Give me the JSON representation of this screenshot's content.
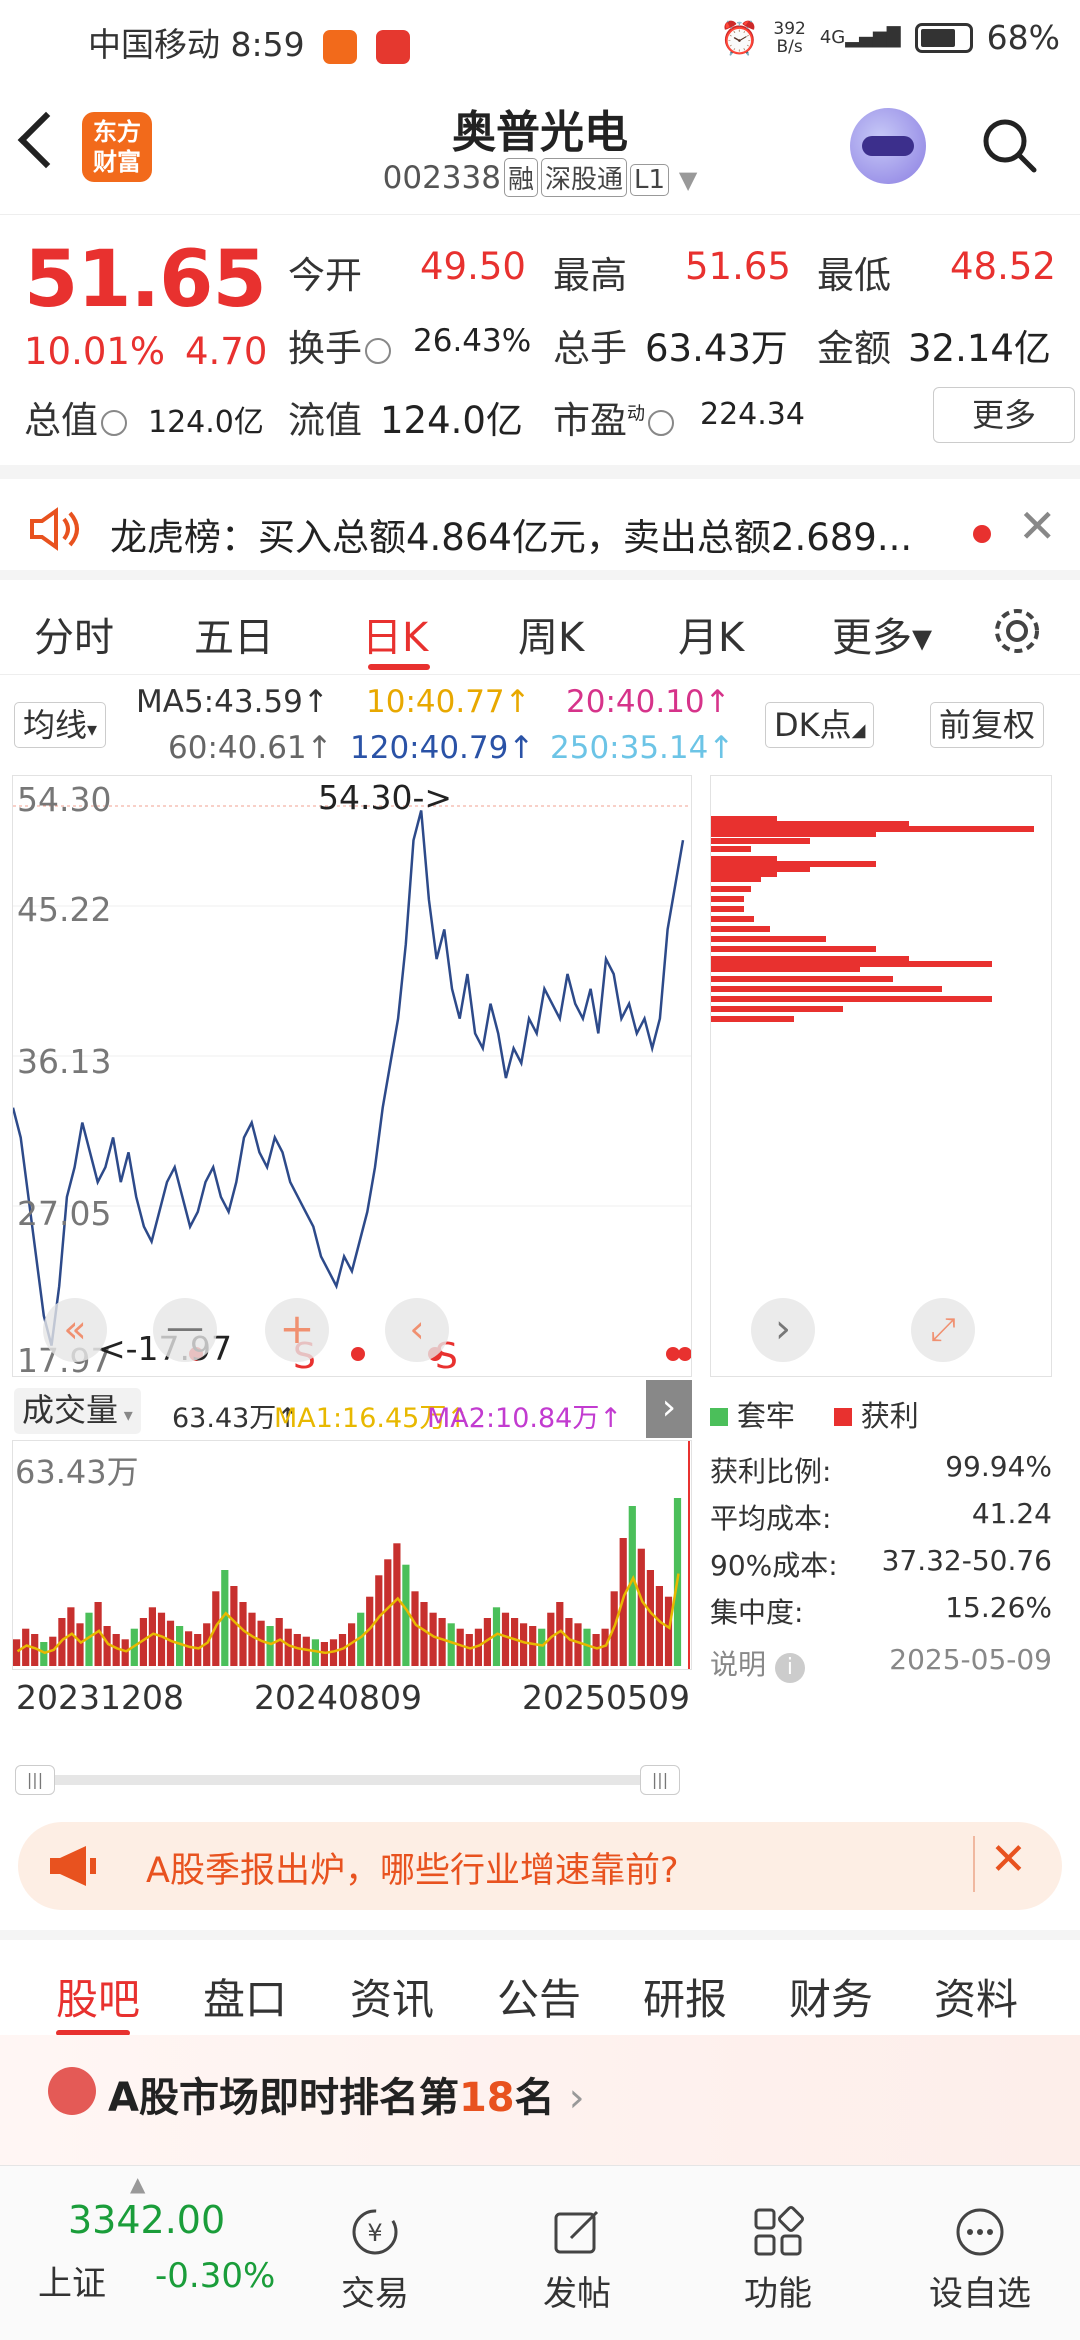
{
  "status": {
    "carrier": "中国移动",
    "time": "8:59",
    "net_speed_value": "392",
    "net_speed_unit": "B/s",
    "signal": "4G",
    "battery": "68%"
  },
  "header": {
    "logo_line1": "东方",
    "logo_line2": "财富",
    "title": "奥普光电",
    "code": "002338",
    "tags": [
      "融",
      "深股通",
      "L1"
    ]
  },
  "quote": {
    "price": "51.65",
    "change_pct": "10.01%",
    "change_amt": "4.70",
    "open_label": "今开",
    "open": "49.50",
    "high_label": "最高",
    "high": "51.65",
    "low_label": "最低",
    "low": "48.52",
    "turnover_label": "换手",
    "turnover": "26.43%",
    "volume_label": "总手",
    "volume": "63.43万",
    "amount_label": "金额",
    "amount": "32.14亿",
    "mktcap_label": "总值",
    "mktcap": "124.0亿",
    "float_label": "流值",
    "float": "124.0亿",
    "pe_label": "市盈",
    "pe_sup": "动",
    "pe": "224.34",
    "more_label": "更多"
  },
  "announce": {
    "text": "龙虎榜：买入总额4.864亿元，卖出总额2.689..."
  },
  "tabs": [
    {
      "label": "分时"
    },
    {
      "label": "五日"
    },
    {
      "label": "日K"
    },
    {
      "label": "周K"
    },
    {
      "label": "月K"
    },
    {
      "label": "更多▾"
    }
  ],
  "ma": {
    "select": "均线",
    "ma5": "MA5:43.59↑",
    "ma10": "10:40.77↑",
    "ma20": "20:40.10↑",
    "ma60": "60:40.61↑",
    "ma120": "120:40.79↑",
    "ma250": "250:35.14↑",
    "dk": "DK点",
    "fq": "前复权"
  },
  "chart_data": {
    "type": "line",
    "title": "",
    "y_ticks": [
      "54.30",
      "45.22",
      "36.13",
      "27.05",
      "17.97"
    ],
    "ylim": [
      17.97,
      54.3
    ],
    "max_label": "54.30->",
    "min_label": "<-17.97",
    "x_ticks": [
      "20231208",
      "20240809",
      "20250509"
    ],
    "close": [
      34,
      32,
      28,
      24,
      20,
      18,
      22,
      28,
      30,
      33,
      31,
      29,
      30,
      32,
      29,
      31,
      28,
      26,
      25,
      27,
      29,
      30,
      28,
      26,
      27,
      29,
      30,
      28,
      27,
      29,
      32,
      33,
      31,
      30,
      32,
      31,
      29,
      28,
      27,
      26,
      24,
      23,
      22,
      24,
      23,
      25,
      27,
      30,
      34,
      37,
      40,
      45,
      52,
      54,
      48,
      44,
      46,
      42,
      40,
      43,
      39,
      38,
      41,
      39,
      36,
      38,
      37,
      40,
      39,
      42,
      41,
      40,
      43,
      41,
      40,
      42,
      39,
      44,
      43,
      40,
      41,
      39,
      40,
      38,
      40,
      46,
      49,
      52
    ]
  },
  "chart_markers": {
    "s1": "S",
    "s2": "S"
  },
  "volume": {
    "select": "成交量",
    "total": "63.43万↑",
    "ma1": "MA1:16.45万↑",
    "ma2": "MA2:10.84万↑",
    "ymax": "63.43万",
    "values": [
      10,
      14,
      12,
      9,
      11,
      18,
      22,
      16,
      20,
      24,
      15,
      12,
      10,
      14,
      18,
      22,
      20,
      17,
      15,
      13,
      12,
      16,
      28,
      36,
      30,
      24,
      20,
      17,
      15,
      18,
      14,
      12,
      11,
      10,
      9,
      10,
      12,
      16,
      20,
      26,
      34,
      40,
      46,
      38,
      28,
      24,
      20,
      18,
      16,
      14,
      12,
      14,
      18,
      22,
      20,
      18,
      16,
      15,
      14,
      20,
      24,
      18,
      16,
      14,
      12,
      14,
      28,
      48,
      60,
      44,
      36,
      30,
      26,
      63
    ]
  },
  "chip": {
    "legend_loss": "套牢",
    "legend_profit": "获利",
    "profit_ratio_label": "获利比例:",
    "profit_ratio": "99.94%",
    "avg_cost_label": "平均成本:",
    "avg_cost": "41.24",
    "cost90_label": "90%成本:",
    "cost90": "37.32-50.76",
    "concentration_label": "集中度:",
    "concentration": "15.26%",
    "note_label": "说明",
    "date": "2025-05-09"
  },
  "promo": {
    "text": "A股季报出炉，哪些行业增速靠前?"
  },
  "subtabs": [
    {
      "label": "股吧"
    },
    {
      "label": "盘口"
    },
    {
      "label": "资讯"
    },
    {
      "label": "公告"
    },
    {
      "label": "研报"
    },
    {
      "label": "财务"
    },
    {
      "label": "资料"
    }
  ],
  "rank": {
    "text_pre": "A股市场即时排名第",
    "rank": "18",
    "text_post": "名"
  },
  "bottom": {
    "index_value": "3342.00",
    "index_name": "上证",
    "index_change": "-0.30%",
    "trade": "交易",
    "post": "发帖",
    "func": "功能",
    "fav": "设自选"
  }
}
